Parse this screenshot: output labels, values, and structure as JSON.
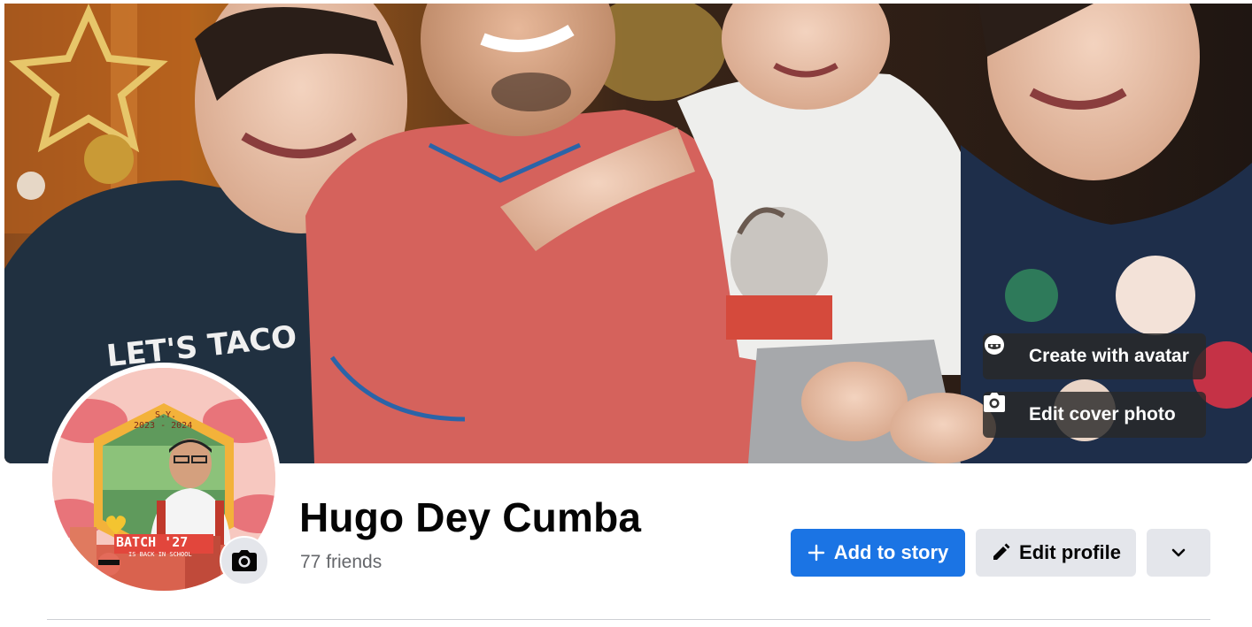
{
  "cover": {
    "create_avatar_label": "Create with avatar",
    "edit_cover_label": "Edit cover photo",
    "shirt_text": "LET'S TACO"
  },
  "profile_picture": {
    "frame_text_sy": "S.Y.",
    "frame_text_years": "2023 - 2024",
    "frame_text_batch": "BATCH '27",
    "frame_text_back": "IS BACK IN SCHOOL"
  },
  "profile": {
    "name": "Hugo Dey Cumba",
    "friends": "77 friends"
  },
  "actions": {
    "add_to_story": "Add to story",
    "edit_profile": "Edit profile"
  },
  "colors": {
    "primary": "#1b74e4",
    "secondary_button": "#e4e6eb",
    "text_secondary": "#65676b"
  }
}
